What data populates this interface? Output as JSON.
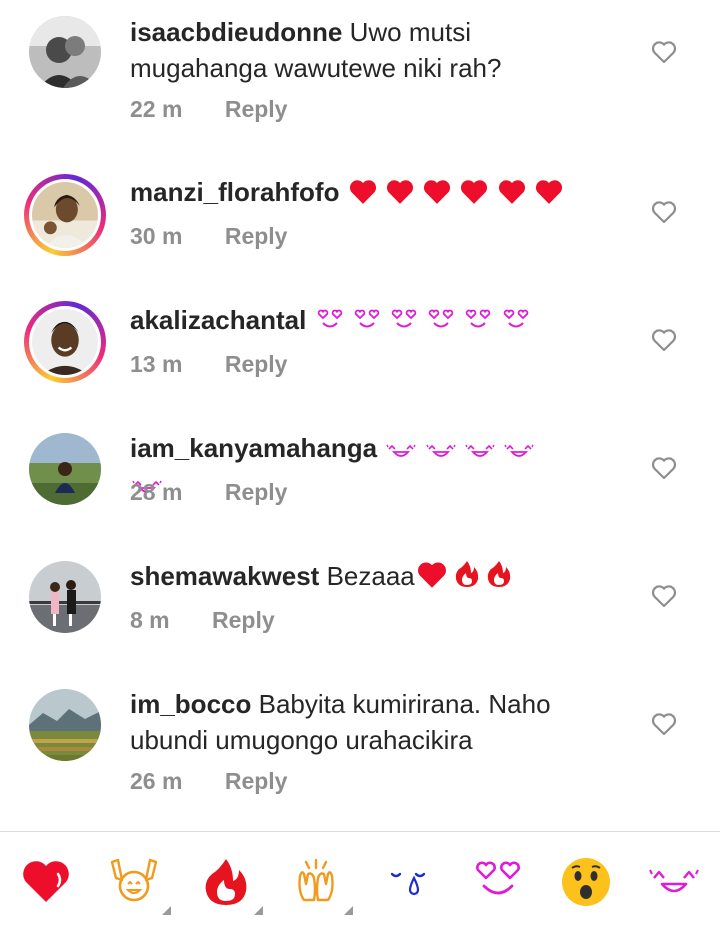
{
  "comments": [
    {
      "username": "isaacbdieudonne",
      "text": "Uwo mutsi",
      "text_line2": "mugahanga wawutewe niki rah?",
      "time": "22 m",
      "reply": "Reply",
      "avatar": "avatar-photo-couple-bw",
      "story_ring": false
    },
    {
      "username": "manzi_florahfofo",
      "text": "",
      "emoji": "red-heart ×6",
      "time": "30 m",
      "reply": "Reply",
      "avatar": "avatar-photo-woman",
      "story_ring": true
    },
    {
      "username": "akalizachantal",
      "text": "",
      "emoji": "smiling-heart-eyes ×6",
      "time": "13 m",
      "reply": "Reply",
      "avatar": "avatar-photo-woman-smiling",
      "story_ring": true
    },
    {
      "username": "iam_kanyamahanga",
      "text": "",
      "emoji": "laughing-face ×5",
      "time": "28 m",
      "reply": "Reply",
      "avatar": "avatar-photo-man-outdoors",
      "story_ring": false
    },
    {
      "username": "shemawakwest",
      "text": "Bezaaa",
      "emoji": "red-heart, fire ×2",
      "time": "8 m",
      "reply": "Reply",
      "avatar": "avatar-photo-group",
      "story_ring": false
    },
    {
      "username": "im_bocco",
      "text": "Babyita kumirirana. Naho",
      "text_line2": "ubundi umugongo urahacikira",
      "time": "26 m",
      "reply": "Reply",
      "avatar": "avatar-photo-landscape",
      "story_ring": false
    }
  ],
  "quick_reactions": [
    "red-heart",
    "raising-hands",
    "fire",
    "clapping-hands",
    "crying-face",
    "smiling-heart-eyes",
    "astonished-face",
    "laughing-face"
  ],
  "colors": {
    "text": "#262626",
    "meta": "#8e8e8e",
    "heart_red": "#ed0e2b",
    "magenta": "#e01bd8",
    "orange": "#f39a1c",
    "blue": "#1c2bd6"
  }
}
